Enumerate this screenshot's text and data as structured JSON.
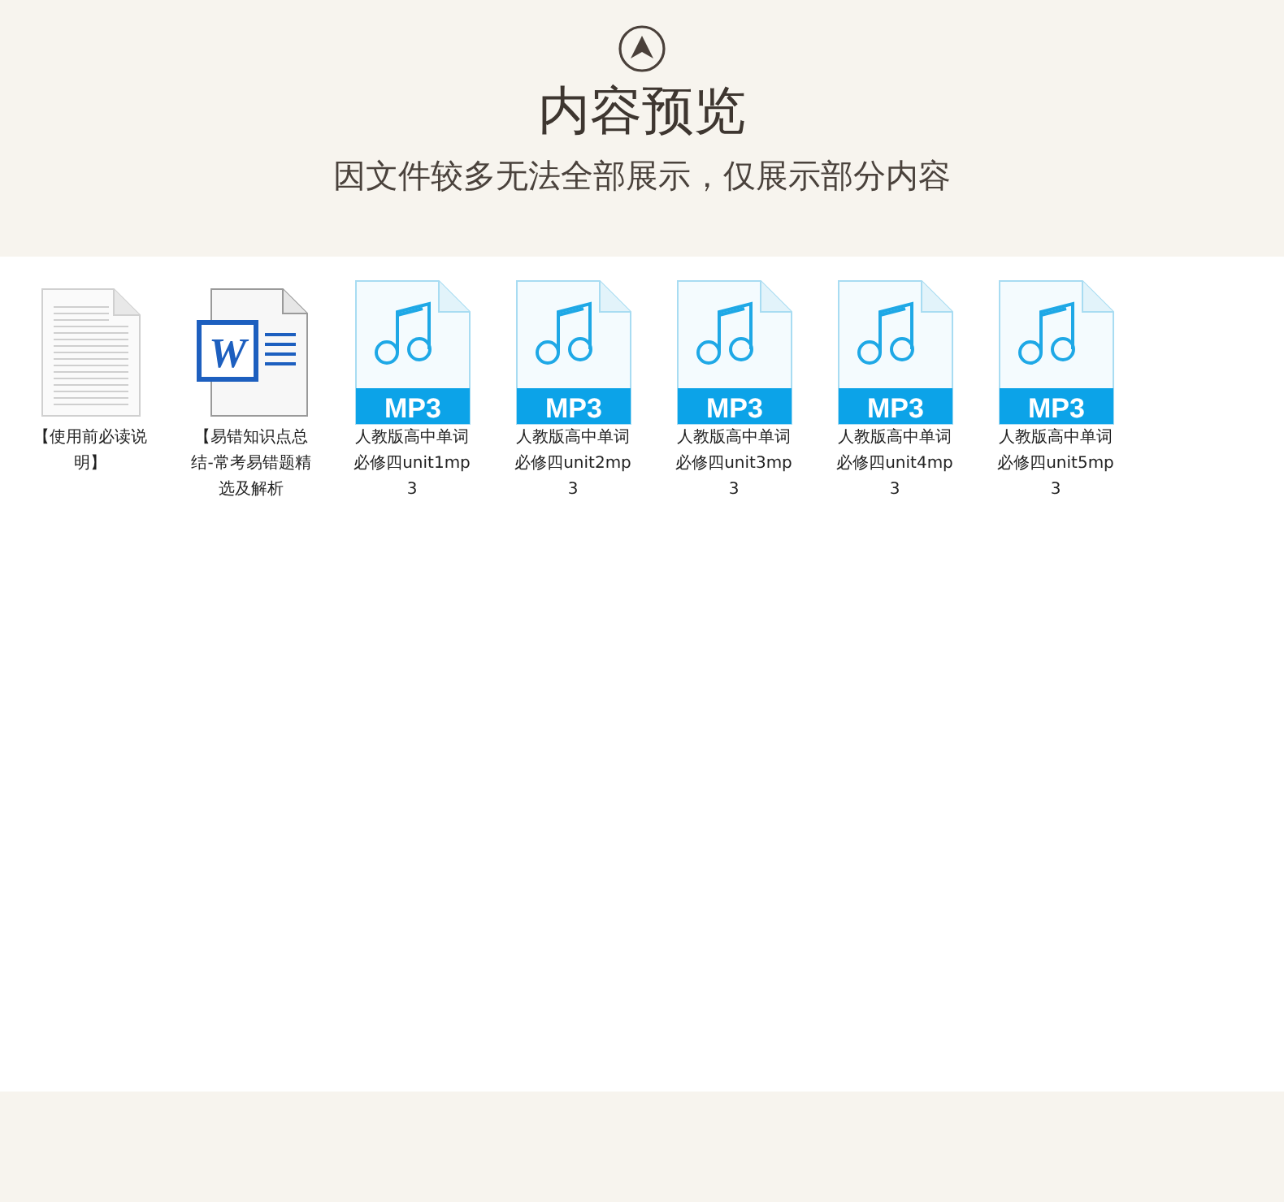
{
  "header": {
    "title": "内容预览",
    "subtitle": "因文件较多无法全部展示，仅展示部分内容"
  },
  "files": [
    {
      "kind": "text",
      "name": "【使用前必读说明】"
    },
    {
      "kind": "word",
      "name": "【易错知识点总结-常考易错题精选及解析",
      "badge": "W"
    },
    {
      "kind": "mp3",
      "name": "人教版高中单词必修四unit1mp3",
      "badge": "MP3"
    },
    {
      "kind": "mp3",
      "name": "人教版高中单词必修四unit2mp3",
      "badge": "MP3"
    },
    {
      "kind": "mp3",
      "name": "人教版高中单词必修四unit3mp3",
      "badge": "MP3"
    },
    {
      "kind": "mp3",
      "name": "人教版高中单词必修四unit4mp3",
      "badge": "MP3"
    },
    {
      "kind": "mp3",
      "name": "人教版高中单词必修四unit5mp3",
      "badge": "MP3"
    }
  ]
}
